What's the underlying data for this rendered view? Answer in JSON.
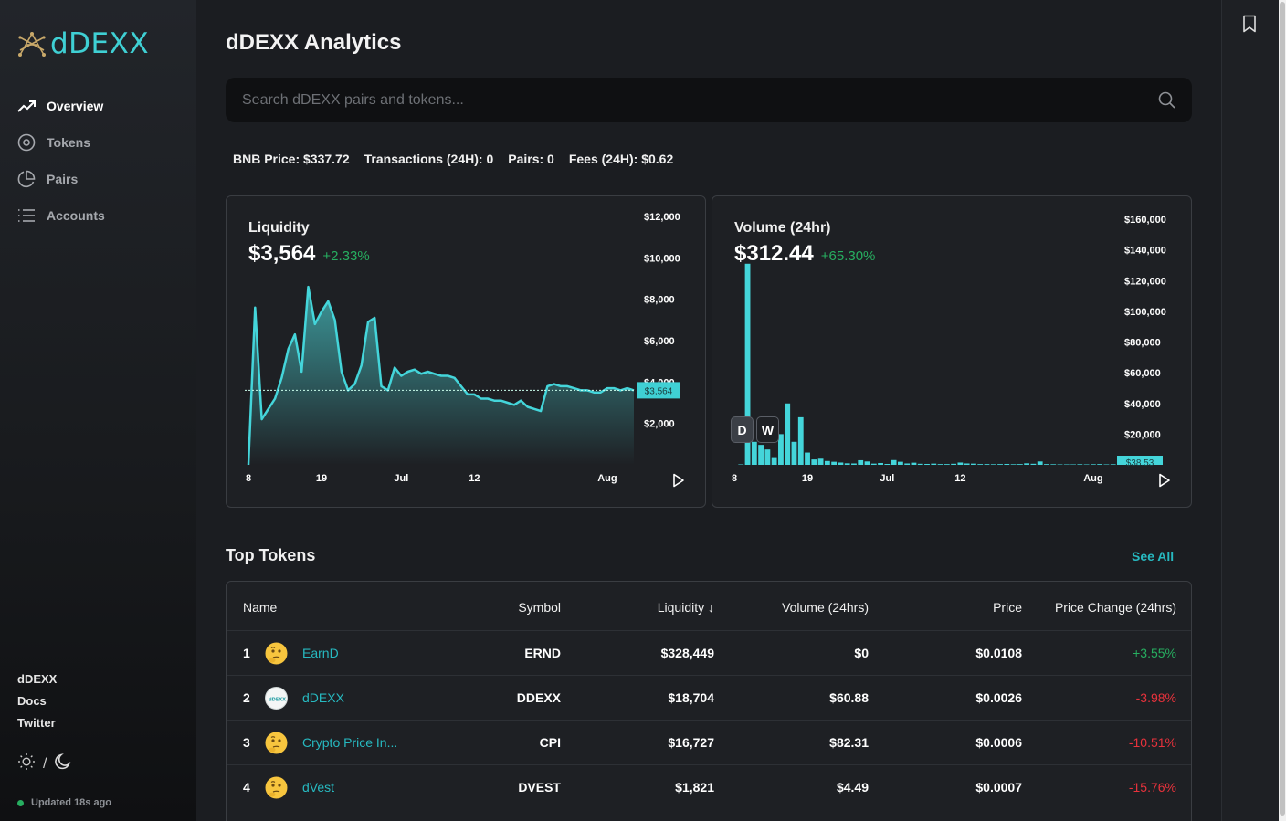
{
  "brand": {
    "name": "dDEXX"
  },
  "nav": [
    {
      "label": "Overview",
      "icon": "trending-up-icon",
      "active": true
    },
    {
      "label": "Tokens",
      "icon": "disc-icon",
      "active": false
    },
    {
      "label": "Pairs",
      "icon": "pie-chart-icon",
      "active": false
    },
    {
      "label": "Accounts",
      "icon": "list-icon",
      "active": false
    }
  ],
  "side_links": [
    "dDEXX",
    "Docs",
    "Twitter"
  ],
  "theme_separator": "/",
  "updated": "Updated 18s ago",
  "page_title": "dDEXX Analytics",
  "search": {
    "placeholder": "Search dDEXX pairs and tokens..."
  },
  "stats": {
    "bnb_price": "BNB Price: $337.72",
    "transactions": "Transactions (24H): 0",
    "pairs": "Pairs: 0",
    "fees": "Fees (24H): $0.62"
  },
  "liquidity_card": {
    "title": "Liquidity",
    "value": "$3,564",
    "change": "+2.33%",
    "current_label": "$3,564"
  },
  "volume_card": {
    "title": "Volume (24hr)",
    "value": "$312.44",
    "change": "+65.30%",
    "current_label": "$38.53",
    "btn_d": "D",
    "btn_w": "W"
  },
  "chart_data": [
    {
      "type": "area",
      "title": "Liquidity",
      "y_ticks": [
        "$12,000",
        "$10,000",
        "$8,000",
        "$6,000",
        "$4,000",
        "$2,000"
      ],
      "y_tick_values": [
        12000,
        10000,
        8000,
        6000,
        4000,
        2000
      ],
      "ylim": [
        0,
        12000
      ],
      "x_ticks": [
        "8",
        "19",
        "Jul",
        "12",
        "Aug"
      ],
      "x_tick_positions": [
        0,
        11,
        23,
        34,
        54
      ],
      "x_count": 59,
      "values": [
        0,
        7600,
        2200,
        2700,
        3200,
        4200,
        5600,
        6300,
        4500,
        8600,
        6800,
        7400,
        7900,
        7000,
        4500,
        3600,
        3900,
        4800,
        6900,
        7100,
        3800,
        3600,
        4700,
        4300,
        4500,
        4600,
        4400,
        4500,
        4400,
        4300,
        4300,
        4200,
        3800,
        3400,
        3400,
        3200,
        3200,
        3100,
        3100,
        3000,
        2900,
        3100,
        2800,
        2700,
        2600,
        3800,
        3900,
        3800,
        3800,
        3700,
        3600,
        3600,
        3500,
        3500,
        3700,
        3700,
        3600,
        3700,
        3600
      ]
    },
    {
      "type": "bar",
      "title": "Volume (24hr)",
      "y_ticks": [
        "$160,000",
        "$140,000",
        "$120,000",
        "$100,000",
        "$80,000",
        "$60,000",
        "$40,000",
        "$20,000"
      ],
      "y_tick_values": [
        160000,
        140000,
        120000,
        100000,
        80000,
        60000,
        40000,
        20000
      ],
      "ylim": [
        0,
        163000
      ],
      "x_ticks": [
        "8",
        "19",
        "Jul",
        "12",
        "Aug"
      ],
      "x_tick_positions": [
        0,
        11,
        23,
        34,
        54
      ],
      "x_count": 59,
      "values": [
        0,
        300,
        131000,
        15000,
        13000,
        10000,
        5000,
        20000,
        40000,
        15000,
        31000,
        8000,
        3500,
        4000,
        2500,
        2000,
        1500,
        1000,
        900,
        3000,
        2200,
        800,
        1200,
        600,
        3100,
        2000,
        900,
        1400,
        700,
        600,
        800,
        500,
        500,
        700,
        1500,
        900,
        800,
        500,
        500,
        400,
        500,
        600,
        400,
        500,
        1000,
        700,
        2200,
        500,
        400,
        300,
        300,
        300,
        400,
        300,
        400,
        500,
        300,
        400,
        300
      ]
    }
  ],
  "top_tokens": {
    "title": "Top Tokens",
    "see_all": "See All",
    "columns": [
      "Name",
      "Symbol",
      "Liquidity ↓",
      "Volume (24hrs)",
      "Price",
      "Price Change (24hrs)"
    ],
    "rows": [
      {
        "rank": "1",
        "name": "EarnD",
        "icon": "thinking-face-icon",
        "symbol": "ERND",
        "liquidity": "$328,449",
        "volume": "$0",
        "price": "$0.0108",
        "change": "+3.55%",
        "up": true
      },
      {
        "rank": "2",
        "name": "dDEXX",
        "icon": "ddexx-token-icon",
        "symbol": "DDEXX",
        "liquidity": "$18,704",
        "volume": "$60.88",
        "price": "$0.0026",
        "change": "-3.98%",
        "up": false
      },
      {
        "rank": "3",
        "name": "Crypto Price In...",
        "icon": "thinking-face-icon",
        "symbol": "CPI",
        "liquidity": "$16,727",
        "volume": "$82.31",
        "price": "$0.0006",
        "change": "-10.51%",
        "up": false
      },
      {
        "rank": "4",
        "name": "dVest",
        "icon": "thinking-face-icon",
        "symbol": "DVEST",
        "liquidity": "$1,821",
        "volume": "$4.49",
        "price": "$0.0007",
        "change": "-15.76%",
        "up": false
      }
    ]
  }
}
